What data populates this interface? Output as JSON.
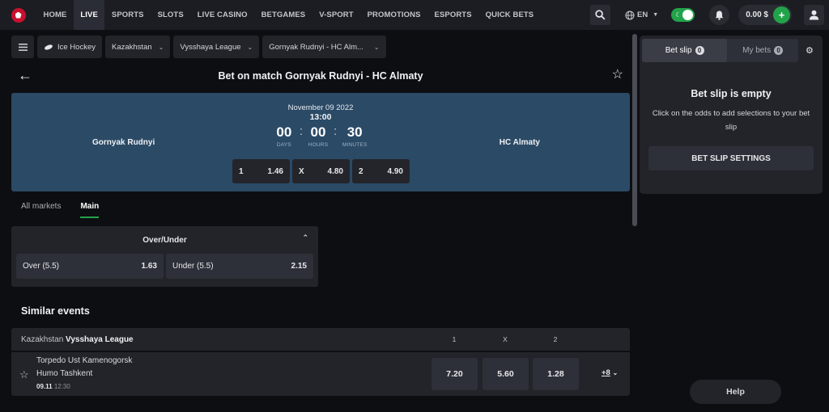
{
  "topbar": {
    "nav": [
      {
        "label": "HOME",
        "active": false
      },
      {
        "label": "LIVE",
        "active": true
      },
      {
        "label": "SPORTS",
        "active": false
      },
      {
        "label": "SLOTS",
        "active": false
      },
      {
        "label": "LIVE CASINO",
        "active": false
      },
      {
        "label": "BETGAMES",
        "active": false
      },
      {
        "label": "V-SPORT",
        "active": false
      },
      {
        "label": "PROMOTIONS",
        "active": false
      },
      {
        "label": "ESPORTS",
        "active": false
      },
      {
        "label": "QUICK BETS",
        "active": false
      }
    ],
    "language": "EN",
    "balance": "0.00 $",
    "theme_toggle_on": true,
    "accent_color": "#22a34a"
  },
  "breadcrumb": {
    "sport": "Ice Hockey",
    "country": "Kazakhstan",
    "league": "Vysshaya League",
    "match": "Gornyak Rudnyi - HC Alm..."
  },
  "page": {
    "title": "Bet on match Gornyak Rudnyi - HC Almaty"
  },
  "match": {
    "home_team": "Gornyak Rudnyi",
    "away_team": "HC Almaty",
    "date": "November 09 2022",
    "time": "13:00",
    "countdown": {
      "days": "00",
      "days_label": "DAYS",
      "hours": "00",
      "hours_label": "HOURS",
      "minutes": "30",
      "minutes_label": "MINUTES"
    },
    "odds": [
      {
        "label": "1",
        "value": "1.46"
      },
      {
        "label": "X",
        "value": "4.80"
      },
      {
        "label": "2",
        "value": "4.90"
      }
    ],
    "panel_color": "#2b4a66"
  },
  "market_tabs": [
    {
      "label": "All markets",
      "active": false
    },
    {
      "label": "Main",
      "active": true
    }
  ],
  "market": {
    "title": "Over/Under",
    "options": [
      {
        "label": "Over (5.5)",
        "value": "1.63"
      },
      {
        "label": "Under (5.5)",
        "value": "2.15"
      }
    ]
  },
  "similar": {
    "title": "Similar events",
    "league_country": "Kazakhstan",
    "league_name": "Vysshaya League",
    "columns": [
      "1",
      "X",
      "2"
    ],
    "events": [
      {
        "team1": "Torpedo Ust Kamenogorsk",
        "team2": "Humo Tashkent",
        "date": "09.11",
        "time": "12:30",
        "odds": [
          "7.20",
          "5.60",
          "1.28"
        ],
        "more": "+8"
      }
    ]
  },
  "betslip": {
    "tab_betslip": "Bet slip",
    "tab_betslip_count": "0",
    "tab_mybets": "My bets",
    "tab_mybets_count": "0",
    "empty_title": "Bet slip is empty",
    "empty_text": "Click on the odds to add selections to your bet slip",
    "settings_button": "BET SLIP SETTINGS"
  },
  "help": {
    "label": "Help"
  }
}
